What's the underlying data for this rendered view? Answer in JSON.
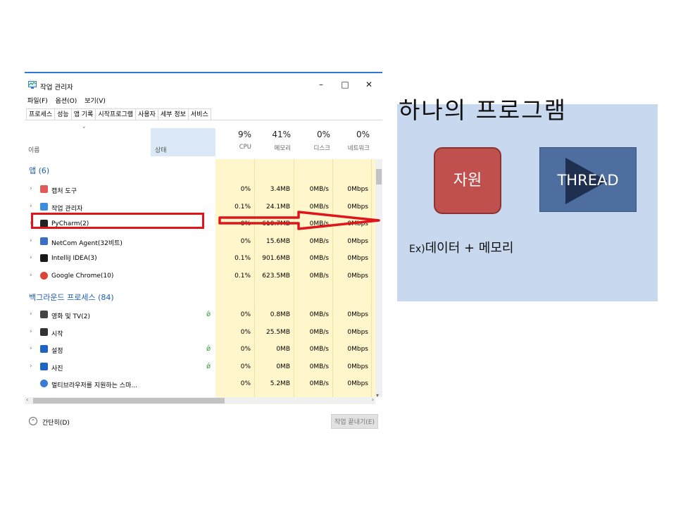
{
  "window": {
    "title": "작업 관리자",
    "minimize": "–",
    "maximize": "□",
    "close": "✕"
  },
  "menu": [
    "파일(F)",
    "옵션(O)",
    "보기(V)"
  ],
  "tabs": [
    "프로세스",
    "성능",
    "앱 기록",
    "시작프로그램",
    "사용자",
    "세부 정보",
    "서비스"
  ],
  "columns": {
    "sort_indicator": "˅",
    "name": "이름",
    "status": "상태",
    "cpu": {
      "pct": "9%",
      "label": "CPU"
    },
    "memory": {
      "pct": "41%",
      "label": "메모리"
    },
    "disk": {
      "pct": "0%",
      "label": "디스크"
    },
    "network": {
      "pct": "0%",
      "label": "네트워크"
    }
  },
  "groups": {
    "apps": "앱 (6)",
    "background": "백그라운드 프로세스 (84)"
  },
  "apps": [
    {
      "name": "캡처 도구",
      "cpu": "0%",
      "memory": "3.4MB",
      "disk": "0MB/s",
      "network": "0Mbps",
      "icon": "snipping-tool-icon",
      "color": "#e05a5a"
    },
    {
      "name": "작업 관리자",
      "cpu": "0.1%",
      "memory": "24.1MB",
      "disk": "0MB/s",
      "network": "0Mbps",
      "icon": "task-manager-icon",
      "color": "#3c8dde"
    },
    {
      "name": "PyCharm(2)",
      "cpu": "0%",
      "memory": "610.7MB",
      "disk": "0MB/s",
      "network": "0Mbps",
      "icon": "pycharm-icon",
      "color": "#222222"
    },
    {
      "name": "NetCom Agent(32비트)",
      "cpu": "0%",
      "memory": "15.6MB",
      "disk": "0MB/s",
      "network": "0Mbps",
      "icon": "netcom-agent-icon",
      "color": "#3a6fc4"
    },
    {
      "name": "IntelliJ IDEA(3)",
      "cpu": "0.1%",
      "memory": "901.6MB",
      "disk": "0MB/s",
      "network": "0Mbps",
      "icon": "intellij-icon",
      "color": "#1a1a1a"
    },
    {
      "name": "Google Chrome(10)",
      "cpu": "0.1%",
      "memory": "623.5MB",
      "disk": "0MB/s",
      "network": "0Mbps",
      "icon": "chrome-icon",
      "color": "#db4437"
    }
  ],
  "background": [
    {
      "name": "영화 및 TV(2)",
      "cpu": "0%",
      "memory": "0.8MB",
      "disk": "0MB/s",
      "network": "0Mbps",
      "icon": "movies-tv-icon",
      "color": "#444444",
      "leaf": true,
      "chevron": true
    },
    {
      "name": "시작",
      "cpu": "0%",
      "memory": "25.5MB",
      "disk": "0MB/s",
      "network": "0Mbps",
      "icon": "start-icon",
      "color": "#333333",
      "leaf": false,
      "chevron": true
    },
    {
      "name": "설정",
      "cpu": "0%",
      "memory": "0MB",
      "disk": "0MB/s",
      "network": "0Mbps",
      "icon": "settings-icon",
      "color": "#1f63c4",
      "leaf": true,
      "chevron": true
    },
    {
      "name": "사진",
      "cpu": "0%",
      "memory": "0MB",
      "disk": "0MB/s",
      "network": "0Mbps",
      "icon": "photos-icon",
      "color": "#1f63c4",
      "leaf": true,
      "chevron": true
    },
    {
      "name": "멀티브라우저를 지원하는 스마...",
      "cpu": "0%",
      "memory": "5.2MB",
      "disk": "0MB/s",
      "network": "0Mbps",
      "icon": "browser-icon",
      "color": "#3a7bd5",
      "leaf": false,
      "chevron": false
    }
  ],
  "footer": {
    "brief": "간단히(D)",
    "end_task": "작업 끝내기(E)"
  },
  "concept": {
    "heading": "하나의 프로그램",
    "resource": "자원",
    "thread": "THREAD",
    "example_prefix": "Ex)",
    "example_text": "데이터 + 메모리"
  },
  "colors": {
    "panel": "#c8d8ef",
    "resource": "#c0504d",
    "thread": "#4f6ea0",
    "highlight": "#e0141b",
    "metric_column": "#fff6cc"
  }
}
